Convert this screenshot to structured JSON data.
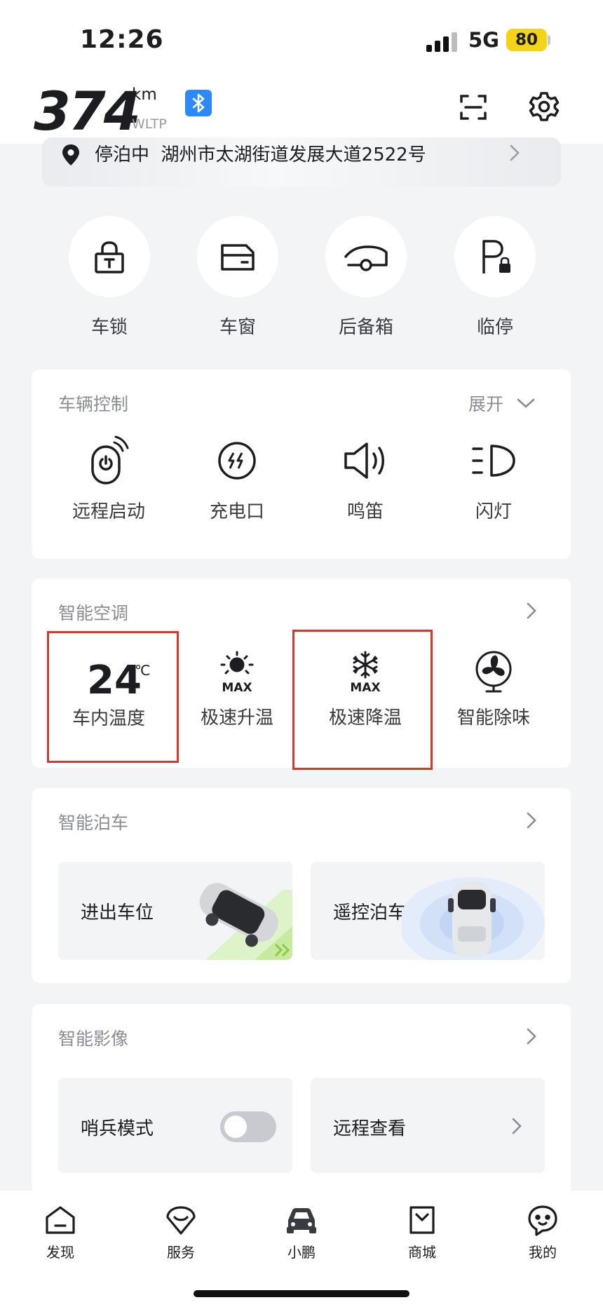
{
  "status_bar": {
    "time": "12:26",
    "network": "5G",
    "battery": "80"
  },
  "header": {
    "range_value": "374",
    "range_unit": "km",
    "range_standard": "WLTP"
  },
  "location": {
    "status": "停泊中",
    "address": "湖州市太湖街道发展大道2522号"
  },
  "quick_actions": [
    {
      "label": "车锁",
      "icon": "lock-icon"
    },
    {
      "label": "车窗",
      "icon": "window-icon"
    },
    {
      "label": "后备箱",
      "icon": "trunk-icon"
    },
    {
      "label": "临停",
      "icon": "parking-icon"
    }
  ],
  "vehicle_control": {
    "title": "车辆控制",
    "expand_label": "展开",
    "items": [
      {
        "label": "远程启动",
        "icon": "remote-start-icon"
      },
      {
        "label": "充电口",
        "icon": "charge-port-icon"
      },
      {
        "label": "鸣笛",
        "icon": "horn-icon"
      },
      {
        "label": "闪灯",
        "icon": "flash-light-icon"
      }
    ]
  },
  "climate": {
    "title": "智能空调",
    "temperature": "24",
    "temperature_unit": "℃",
    "items": [
      {
        "label": "车内温度"
      },
      {
        "label": "极速升温",
        "badge": "MAX",
        "icon": "sun-max-icon"
      },
      {
        "label": "极速降温",
        "badge": "MAX",
        "icon": "snowflake-max-icon"
      },
      {
        "label": "智能除味",
        "icon": "fan-icon"
      }
    ]
  },
  "parking": {
    "title": "智能泊车",
    "tiles": [
      {
        "label": "进出车位"
      },
      {
        "label": "遥控泊车"
      }
    ]
  },
  "camera": {
    "title": "智能影像",
    "sentry_label": "哨兵模式",
    "sentry_on": false,
    "remote_view_label": "远程查看"
  },
  "tabs": [
    {
      "label": "发现",
      "icon": "discover-icon"
    },
    {
      "label": "服务",
      "icon": "service-icon"
    },
    {
      "label": "小鹏",
      "icon": "car-icon"
    },
    {
      "label": "商城",
      "icon": "store-icon"
    },
    {
      "label": "我的",
      "icon": "profile-icon"
    }
  ],
  "colors": {
    "accent_blue": "#2b8af7",
    "highlight_red": "#d8372b",
    "battery_yellow": "#f5d416"
  }
}
